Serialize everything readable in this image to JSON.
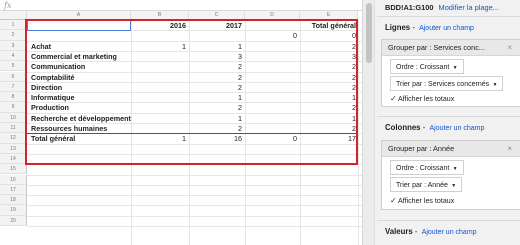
{
  "formula": {
    "fx": "fx"
  },
  "columns": [
    "A",
    "B",
    "C",
    "D",
    "E"
  ],
  "rows": [
    "1",
    "2",
    "3",
    "4",
    "5",
    "6",
    "7",
    "8",
    "9",
    "10",
    "11",
    "12",
    "13",
    "14",
    "15",
    "16",
    "17",
    "18",
    "19",
    "20"
  ],
  "pivot": {
    "header": [
      "",
      "2016",
      "2017",
      "",
      "Total général"
    ],
    "data_rows": [
      {
        "label": "",
        "v2016": "",
        "v2017": "",
        "vblank": "0",
        "total": "0"
      },
      {
        "label": "Achat",
        "v2016": "1",
        "v2017": "1",
        "vblank": "",
        "total": "2"
      },
      {
        "label": "Commercial et marketing",
        "v2016": "",
        "v2017": "3",
        "vblank": "",
        "total": "3"
      },
      {
        "label": "Communication",
        "v2016": "",
        "v2017": "2",
        "vblank": "",
        "total": "2"
      },
      {
        "label": "Comptabilité",
        "v2016": "",
        "v2017": "2",
        "vblank": "",
        "total": "2"
      },
      {
        "label": "Direction",
        "v2016": "",
        "v2017": "2",
        "vblank": "",
        "total": "2"
      },
      {
        "label": "Informatique",
        "v2016": "",
        "v2017": "1",
        "vblank": "",
        "total": "1"
      },
      {
        "label": "Production",
        "v2016": "",
        "v2017": "2",
        "vblank": "",
        "total": "2"
      },
      {
        "label": "Recherche et développement",
        "v2016": "",
        "v2017": "1",
        "vblank": "",
        "total": "1"
      },
      {
        "label": "Ressources humaines",
        "v2016": "",
        "v2017": "2",
        "vblank": "",
        "total": "2"
      }
    ],
    "total_row": {
      "label": "Total général",
      "v2016": "1",
      "v2017": "16",
      "vblank": "0",
      "total": "17"
    }
  },
  "panel": {
    "range": "BDD!A1:G100",
    "range_link": "Modifier la plage...",
    "lignes": {
      "title": "Lignes",
      "add": "Ajouter un champ",
      "card_title": "Grouper par : Services conc...",
      "close": "×",
      "order": "Ordre : Croissant",
      "sort": "Trier par : Services concernés",
      "totals": "Afficher les totaux"
    },
    "colonnes": {
      "title": "Colonnes",
      "add": "Ajouter un champ",
      "card_title": "Grouper par : Année",
      "close": "×",
      "order": "Ordre : Croissant",
      "sort": "Trier par : Année",
      "totals": "Afficher les totaux"
    },
    "valeurs": {
      "title": "Valeurs",
      "add": "Ajouter un champ"
    }
  }
}
